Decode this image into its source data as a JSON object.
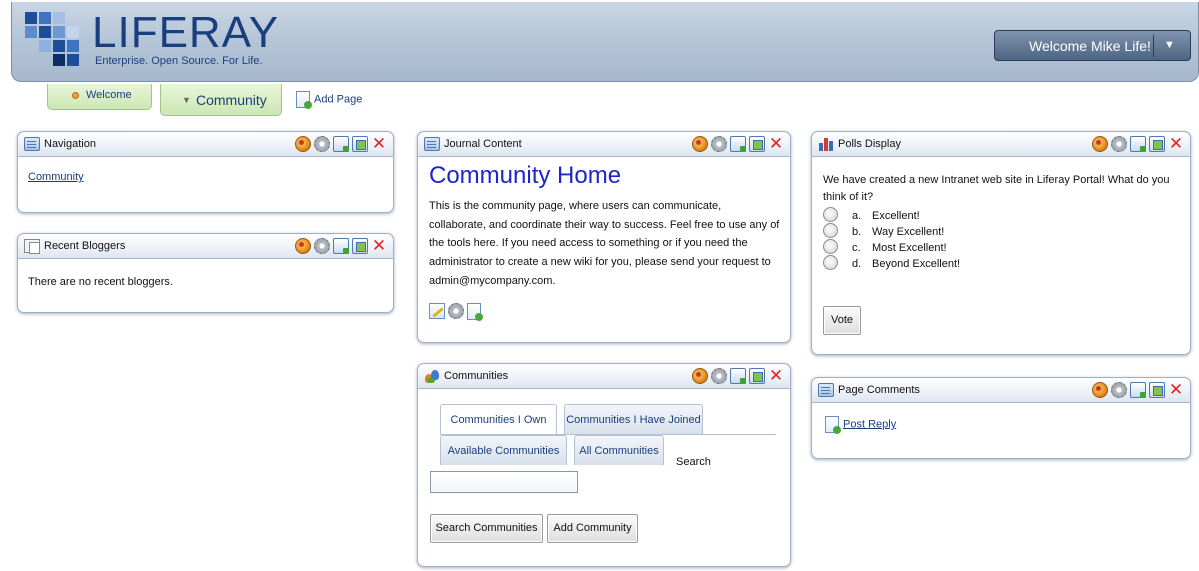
{
  "header": {
    "logo_text": "LIFERAY",
    "logo_tagline": "Enterprise. Open Source. For Life.",
    "welcome_label": "Welcome Mike Life!",
    "welcome_menu_icon": "caret-down-icon"
  },
  "nav": {
    "tabs": [
      {
        "label": "Welcome"
      },
      {
        "label": "Community",
        "selected": true
      }
    ],
    "add_page_label": "Add Page"
  },
  "portlet_controls": [
    "look-and-feel-icon",
    "configuration-icon",
    "minimize-icon",
    "maximize-icon",
    "close-icon"
  ],
  "navigation": {
    "title": "Navigation",
    "link": "Community"
  },
  "recent_bloggers": {
    "title": "Recent Bloggers",
    "message": "There are no recent bloggers."
  },
  "journal": {
    "title": "Journal Content",
    "heading": "Community Home",
    "text": "This is the community page, where users can communicate, collaborate, and coordinate their way to success. Feel free to use any of the tools here. If you need access to something or if you need the administrator to create a new wiki for you, please send your request to admin@mycompany.com."
  },
  "communities": {
    "title": "Communities",
    "tabs": [
      "Communities I Own",
      "Communities I Have Joined",
      "Available Communities",
      "All Communities"
    ],
    "search_label": "Search",
    "search_value": "",
    "search_button": "Search Communities",
    "add_button": "Add Community"
  },
  "polls": {
    "title": "Polls Display",
    "question": "We have created a new Intranet web site in Liferay Portal! What do you think of it?",
    "options": [
      {
        "letter": "a.",
        "text": "Excellent!"
      },
      {
        "letter": "b.",
        "text": "Way Excellent!"
      },
      {
        "letter": "c.",
        "text": "Most Excellent!"
      },
      {
        "letter": "d.",
        "text": "Beyond Excellent!"
      }
    ],
    "vote_label": "Vote"
  },
  "page_comments": {
    "title": "Page Comments",
    "post_reply": "Post Reply"
  },
  "colors": {
    "brand_blue": "#1a3f7d",
    "heading_blue": "#1c27c9",
    "tab_green": "#cbe6b3",
    "close_red": "#e32424"
  }
}
